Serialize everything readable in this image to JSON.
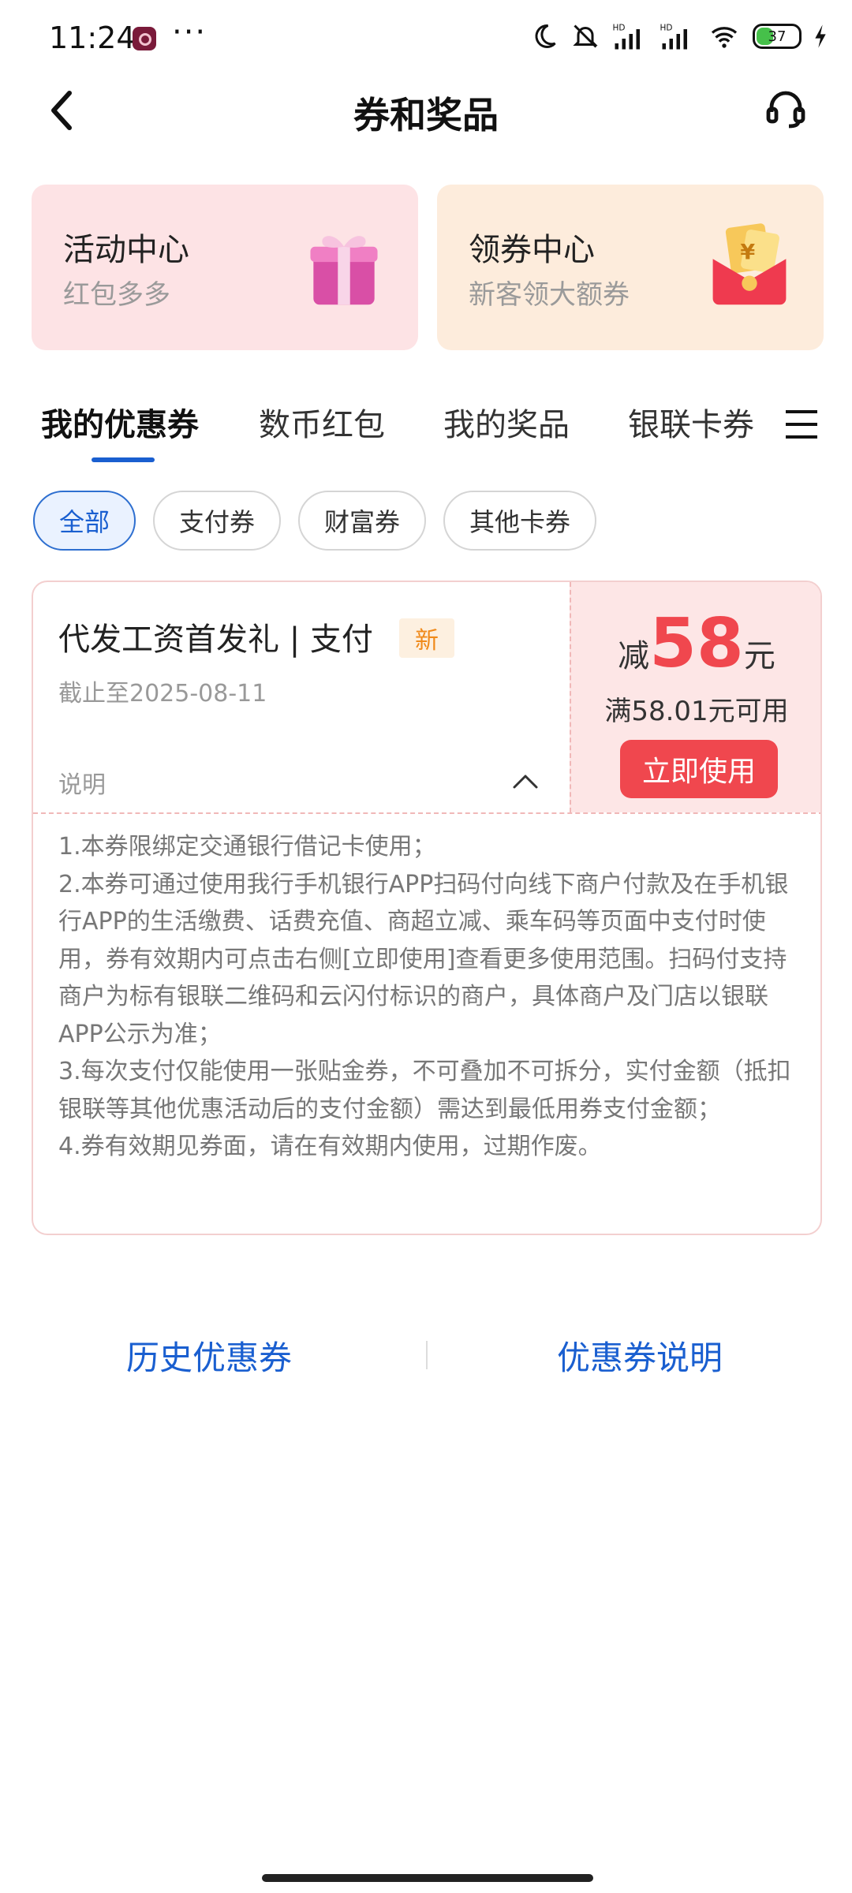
{
  "status_bar": {
    "time": "11:24",
    "more": "···",
    "battery": "37",
    "icons": [
      "moon-icon",
      "mute-icon",
      "hd-signal-icon",
      "hd-signal-icon",
      "wifi-icon",
      "battery-icon",
      "charging-icon"
    ]
  },
  "header": {
    "title": "券和奖品",
    "back_icon": "chevron-left-icon",
    "support_icon": "headset-icon"
  },
  "entries": [
    {
      "title": "活动中心",
      "subtitle": "红包多多",
      "icon": "gift-box-icon"
    },
    {
      "title": "领券中心",
      "subtitle": "新客领大额券",
      "icon": "red-envelope-icon"
    }
  ],
  "tabs": [
    "我的优惠券",
    "数币红包",
    "我的奖品",
    "银联卡券"
  ],
  "active_tab": "我的优惠券",
  "filters": [
    "全部",
    "支付券",
    "财富券",
    "其他卡券"
  ],
  "active_filter": "全部",
  "coupon": {
    "title": "代发工资首发礼 | 支付",
    "badge": "新",
    "expire": "截止至2025-08-11",
    "desc_label": "说明",
    "amount_prefix": "减",
    "amount": "58",
    "amount_suffix": "元",
    "condition": "满58.01元可用",
    "use_button": "立即使用",
    "rules": [
      "1.本券限绑定交通银行借记卡使用；",
      "2.本券可通过使用我行手机银行APP扫码付向线下商户付款及在手机银行APP的生活缴费、话费充值、商超立减、乘车码等页面中支付时使用，券有效期内可点击右侧[立即使用]查看更多使用范围。扫码付支持商户为标有银联二维码和云闪付标识的商户，具体商户及门店以银联APP公示为准；",
      "3.每次支付仅能使用一张贴金券，不可叠加不可拆分，实付金额（抵扣银联等其他优惠活动后的支付金额）需达到最低用券支付金额；",
      "4.券有效期见券面，请在有效期内使用，过期作废。"
    ]
  },
  "footer": {
    "history": "历史优惠券",
    "explain": "优惠券说明"
  },
  "colors": {
    "accent_blue": "#1a5fd0",
    "coupon_red": "#f0474e",
    "activity_bg": "#fde3e5",
    "coupon_center_bg": "#fdecdc"
  }
}
